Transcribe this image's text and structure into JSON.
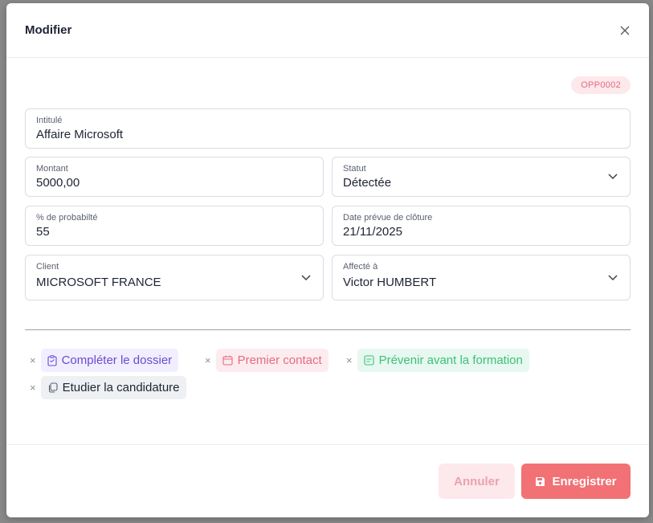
{
  "modal": {
    "title": "Modifier",
    "reference": "OPP0002"
  },
  "form": {
    "intitule": {
      "label": "Intitulé",
      "value": "Affaire Microsoft"
    },
    "montant": {
      "label": "Montant",
      "value": "5000,00"
    },
    "statut": {
      "label": "Statut",
      "value": "Détectée"
    },
    "probabilite": {
      "label": "% de probabilté",
      "value": "55"
    },
    "date_cloture": {
      "label": "Date prévue de clôture",
      "value": "21/11/2025"
    },
    "client": {
      "label": "Client",
      "value": "MICROSOFT FRANCE"
    },
    "affecte": {
      "label": "Affecté à",
      "value": "Victor HUMBERT"
    }
  },
  "tags": [
    {
      "label": "Compléter le dossier",
      "icon": "clipboard-icon",
      "color": "#6a4bd0"
    },
    {
      "label": "Premier contact",
      "icon": "calendar-icon",
      "color": "#e46c7e"
    },
    {
      "label": "Prévenir avant la formation",
      "icon": "note-icon",
      "color": "#3ebf7a"
    },
    {
      "label": "Etudier la candidature",
      "icon": "copy-icon",
      "color": "#1e2433"
    }
  ],
  "footer": {
    "cancel_label": "Annuler",
    "save_label": "Enregistrer"
  },
  "colors": {
    "accent": "#f27174",
    "badge_bg": "#fde8ec"
  }
}
